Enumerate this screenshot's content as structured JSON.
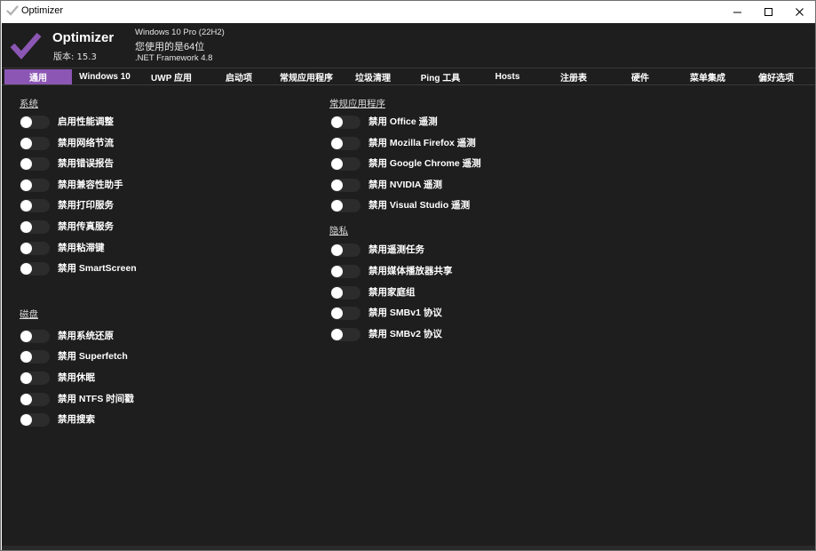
{
  "window": {
    "title": "Optimizer"
  },
  "header": {
    "app_name": "Optimizer",
    "version": "版本: 15.3",
    "os": "Windows 10 Pro (22H2)",
    "bitness": "您使用的是64位",
    "framework": ".NET Framework 4.8"
  },
  "colors": {
    "accent": "#8c57b4",
    "background": "#1e1e1e",
    "toggle_off": "#2c2c2c"
  },
  "tabs": [
    {
      "label": "通用",
      "active": true
    },
    {
      "label": "Windows 10"
    },
    {
      "label": "UWP 应用"
    },
    {
      "label": "启动项"
    },
    {
      "label": "常规应用程序"
    },
    {
      "label": "垃圾清理"
    },
    {
      "label": "Ping 工具"
    },
    {
      "label": "Hosts"
    },
    {
      "label": "注册表"
    },
    {
      "label": "硬件"
    },
    {
      "label": "菜单集成"
    },
    {
      "label": "偏好选项"
    }
  ],
  "sections": {
    "system": {
      "title": "系统",
      "items": [
        {
          "label": "启用性能调整",
          "on": false
        },
        {
          "label": "禁用网络节流",
          "on": false
        },
        {
          "label": "禁用错误报告",
          "on": false
        },
        {
          "label": "禁用兼容性助手",
          "on": false
        },
        {
          "label": "禁用打印服务",
          "on": false
        },
        {
          "label": "禁用传真服务",
          "on": false
        },
        {
          "label": "禁用粘滞键",
          "on": false
        },
        {
          "label": "禁用 SmartScreen",
          "on": false
        }
      ]
    },
    "disk": {
      "title": "磁盘",
      "items": [
        {
          "label": "禁用系统还原",
          "on": false
        },
        {
          "label": "禁用 Superfetch",
          "on": false
        },
        {
          "label": "禁用休眠",
          "on": false
        },
        {
          "label": "禁用 NTFS 时间戳",
          "on": false
        },
        {
          "label": "禁用搜索",
          "on": false
        }
      ]
    },
    "common_apps": {
      "title": "常规应用程序",
      "items": [
        {
          "label": "禁用 Office 遥测",
          "on": false
        },
        {
          "label": "禁用 Mozilla Firefox 遥测",
          "on": false
        },
        {
          "label": "禁用 Google Chrome 遥测",
          "on": false
        },
        {
          "label": "禁用 NVIDIA 遥测",
          "on": false
        },
        {
          "label": "禁用 Visual Studio 遥测",
          "on": false
        }
      ]
    },
    "privacy": {
      "title": "隐私",
      "items": [
        {
          "label": "禁用遥测任务",
          "on": false
        },
        {
          "label": "禁用媒体播放器共享",
          "on": false
        },
        {
          "label": "禁用家庭组",
          "on": false
        },
        {
          "label": "禁用 SMBv1 协议",
          "on": false
        },
        {
          "label": "禁用 SMBv2 协议",
          "on": false
        }
      ]
    }
  }
}
